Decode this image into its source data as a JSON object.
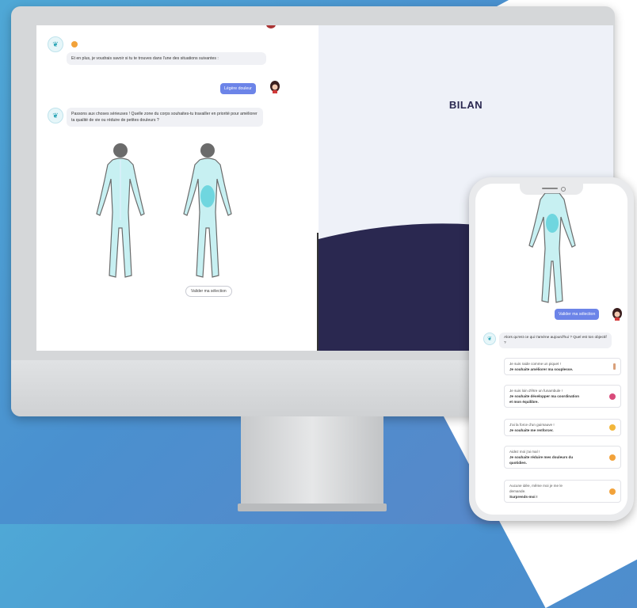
{
  "desktop": {
    "bubble1_text": "Et en plus, je voudrais savoir si tu te trouves dans l'une des situations suivantes :",
    "user_reply": "Légère douleur",
    "bubble2_text": "Passons aux choses sérieuses ! Quelle zone du corps souhaites-tu travailler en priorité pour améliorer ta qualité de vie ou réduire de petites douleurs ?",
    "validate_label": "Valider ma sélection",
    "bilan_title": "BILAN"
  },
  "mobile": {
    "validate_label": "Valider ma sélection",
    "bot_question": "Alors qu'est ce qui t'amène aujourd'hui ? Quel est ton objectif ?",
    "options": [
      {
        "line1": "Je suis raide comme un piquet !",
        "line2": "Je souhaite améliorer ma souplesse.",
        "line3": ""
      },
      {
        "line1": "Je suis loin d'être un funambule !",
        "line2": "Je souhaite développer ma coordination",
        "line3": "et mon équilibre."
      },
      {
        "line1": "J'ai la force d'un guimauve !",
        "line2": "Je souhaite me renforcer.",
        "line3": ""
      },
      {
        "line1": "Aidez moi j'ai mal !",
        "line2": "Je souhaite réduire mes douleurs du",
        "line3": "quotidien."
      },
      {
        "line1": "Aucune idée, même moi je me le",
        "line2": "demande.",
        "line3": "Surprends-moi !"
      }
    ]
  },
  "colors": {
    "accent": "#6c84e8",
    "navy": "#2a2850",
    "body_fill": "#c7f0f2",
    "body_highlight": "#6fd6df"
  }
}
